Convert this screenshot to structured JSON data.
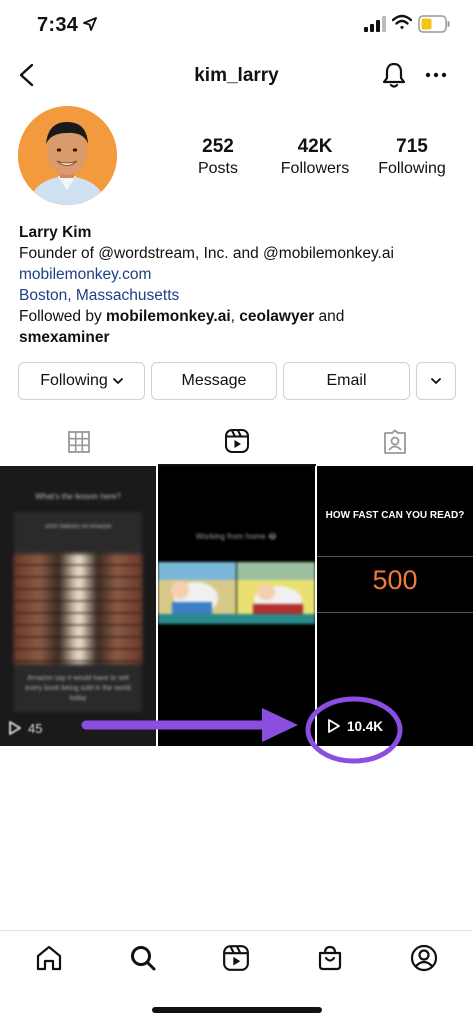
{
  "status_bar": {
    "time": "7:34"
  },
  "header": {
    "username": "kim_larry"
  },
  "profile": {
    "stats": [
      {
        "value": "252",
        "label": "Posts"
      },
      {
        "value": "42K",
        "label": "Followers"
      },
      {
        "value": "715",
        "label": "Following"
      }
    ],
    "bio": {
      "name": "Larry Kim",
      "line1": "Founder of @wordstream, Inc. and @mobilemonkey.ai",
      "website": "mobilemonkey.com",
      "location": "Boston, Massachusetts",
      "followed_prefix": "Followed by ",
      "followed_user1": "mobilemonkey.ai",
      "followed_sep": ", ",
      "followed_user2": "ceolawyer",
      "followed_and": " and",
      "followed_user3": "smexaminer"
    }
  },
  "actions": {
    "following_label": "Following",
    "message_label": "Message",
    "email_label": "Email"
  },
  "tabs": [
    "grid-icon",
    "reels-icon",
    "tagged-icon"
  ],
  "reels": [
    {
      "caption": "What's the lesson here?",
      "sub_caption": "1000 Nations on Amazon",
      "bottom_text": "Amazon say it would have to sell every book being sold in the world today",
      "views": "45"
    },
    {
      "caption": "Working from home 😂",
      "views": ""
    },
    {
      "title": "HOW FAST CAN YOU READ?",
      "number": "500",
      "views": "10.4K"
    }
  ],
  "colors": {
    "link": "#1d3f83",
    "annotation": "#8a4fe0",
    "reel_number": "#f07a3a",
    "avatar_bg": "#f39a3f"
  },
  "bottom_nav": [
    "home-icon",
    "search-icon",
    "reels-icon",
    "shop-icon",
    "profile-icon"
  ]
}
